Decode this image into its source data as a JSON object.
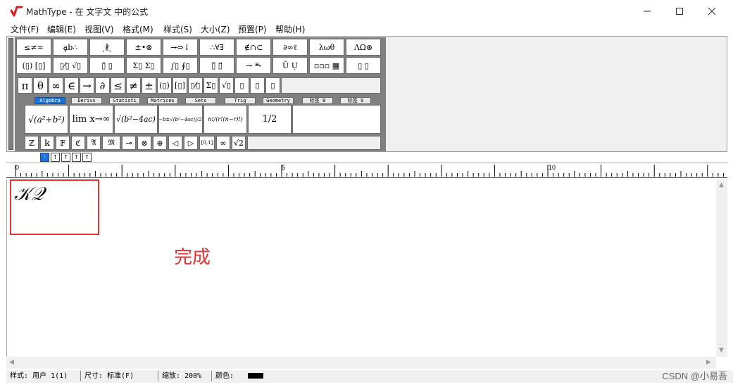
{
  "window": {
    "title": "MathType - 在 文字文 中的公式",
    "minimize_icon": "minimize-icon",
    "maximize_icon": "maximize-icon",
    "close_icon": "close-icon"
  },
  "menu": [
    "文件(F)",
    "编辑(E)",
    "视图(V)",
    "格式(M)",
    "样式(S)",
    "大小(Z)",
    "预置(P)",
    "帮助(H)"
  ],
  "palette_row1": [
    "≤≠≈",
    "ḁb∴",
    "⸼∦⸼",
    "±•⊗",
    "→⇔↓",
    "∴∀∃",
    "∉∩⊂",
    "∂∞ℓ",
    "λωθ",
    "ΛΩ⊛"
  ],
  "palette_row2": [
    "(▯) [▯]",
    "▯⁄▯ √▯",
    "▯̄ ▯̱",
    "Σ▯ Σ▯",
    "∫▯ ∮▯",
    "▯̅ ▯⃗",
    "→ ⥱",
    "Ū Ụ",
    "▫▫▫ ▦",
    "▯ ▯"
  ],
  "small_bar": [
    "π",
    "θ",
    "∞",
    "∈",
    "→",
    "∂",
    "≤",
    "≠",
    "±",
    "(▯)",
    "[▯]",
    "▯⁄▯",
    "Σ▯",
    "√▯",
    "▯",
    "▯",
    "▯"
  ],
  "tabs": [
    "Algebra",
    "Derivs",
    "Statisti",
    "Matrices",
    "Sets",
    "Trig",
    "Geometry",
    "标签 8",
    "标签 9"
  ],
  "templates": [
    "√(a²+b²)",
    "lim x→∞",
    "√(b²−4ac)",
    "(−b±√(b²−4ac))/2a",
    "n!/(r!(n−r)!)",
    "1/2"
  ],
  "bottom_bar": [
    "ℤ",
    "𝕜",
    "𝔽",
    "ℭ",
    "𝔄",
    "𝔐",
    "⊸",
    "⊗",
    "⊕",
    "◁",
    "▷",
    "[0,1]",
    "∞",
    "√2"
  ],
  "size_buttons": [
    "ᵗ",
    "↑",
    "↑",
    "↑",
    "↑"
  ],
  "ruler": {
    "marks": [
      "0",
      "5",
      "10"
    ]
  },
  "editor": {
    "formula": "𝒦𝒬",
    "annotation": "完成"
  },
  "status": {
    "style": "样式: 用户 1(1)",
    "size": "尺寸: 标准(F)",
    "zoom": "缩放: 200%",
    "color": "颜色:",
    "color_value": "#000000"
  },
  "watermark": "CSDN @小易吾"
}
